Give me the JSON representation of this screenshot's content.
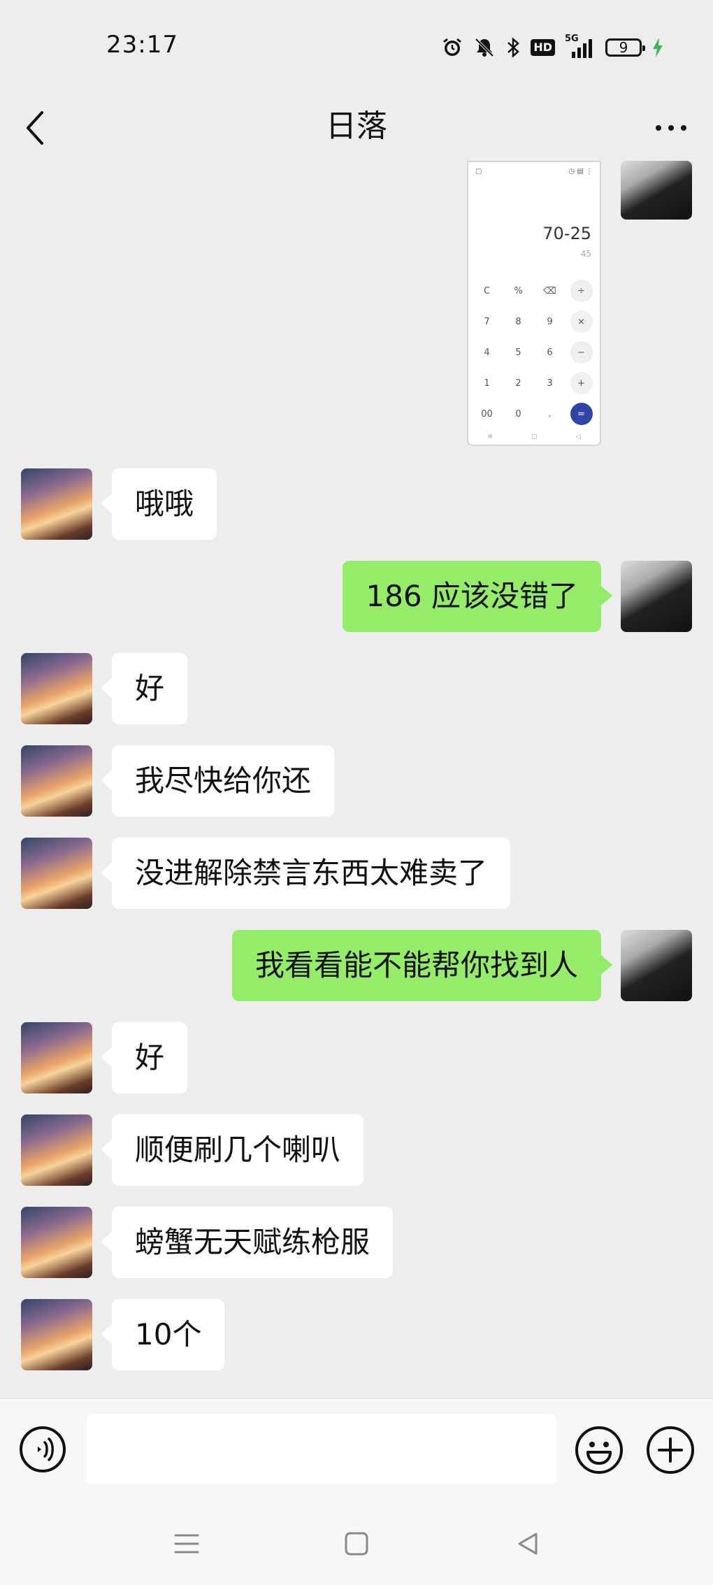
{
  "status_bar": {
    "time": "23:17",
    "signal": "5G",
    "hd": "HD",
    "battery": "9"
  },
  "header": {
    "title": "日落"
  },
  "calc_screenshot": {
    "expression": "70-25",
    "result": "45",
    "keys": [
      "C",
      "%",
      "⌫",
      "÷",
      "7",
      "8",
      "9",
      "×",
      "4",
      "5",
      "6",
      "−",
      "1",
      "2",
      "3",
      "+",
      "00",
      "0",
      ".",
      "="
    ]
  },
  "messages": [
    {
      "side": "in",
      "text": "哦哦"
    },
    {
      "side": "out",
      "text": "186 应该没错了"
    },
    {
      "side": "in",
      "text": "好"
    },
    {
      "side": "in",
      "text": "我尽快给你还"
    },
    {
      "side": "in",
      "text": "没进解除禁言东西太难卖了"
    },
    {
      "side": "out",
      "text": "我看看能不能帮你找到人"
    },
    {
      "side": "in",
      "text": "好"
    },
    {
      "side": "in",
      "text": "顺便刷几个喇叭"
    },
    {
      "side": "in",
      "text": "螃蟹无天赋练枪服"
    },
    {
      "side": "in",
      "text": "10个"
    }
  ],
  "colors": {
    "outgoing_bubble": "#95ec69",
    "incoming_bubble": "#ffffff",
    "background": "#ededed"
  }
}
